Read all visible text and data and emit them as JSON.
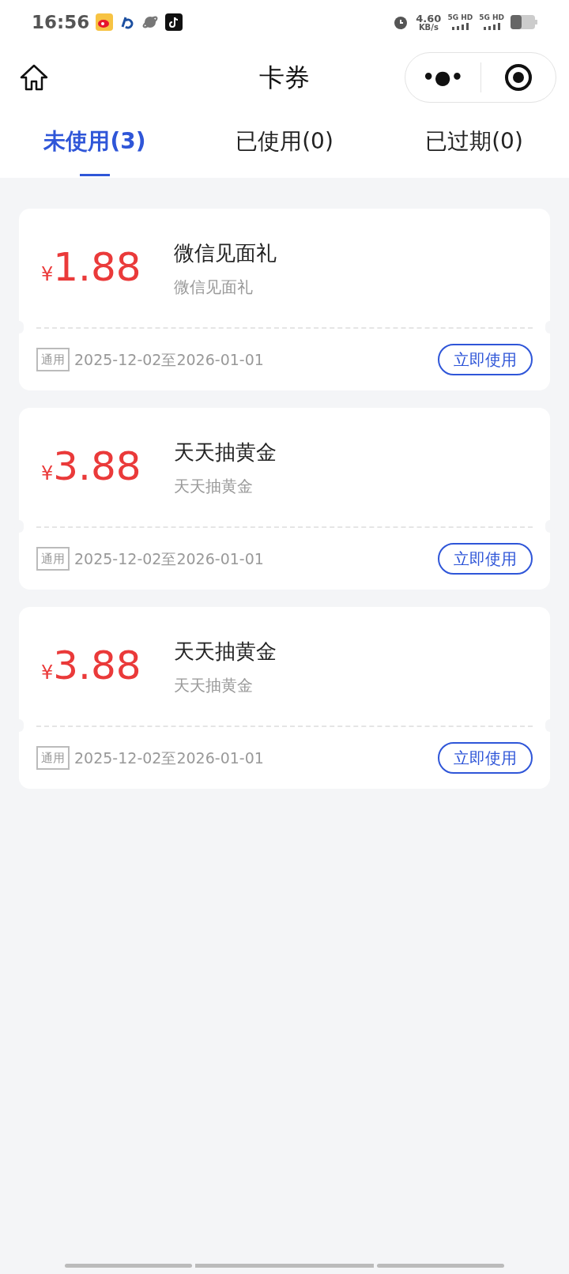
{
  "status_bar": {
    "time": "16:56",
    "speed": "4.60",
    "speed_unit": "KB/s",
    "sim": [
      "5G HD",
      "5G HD"
    ]
  },
  "nav": {
    "title": "卡券",
    "more": "•●•"
  },
  "tabs": [
    {
      "label": "未使用(3)",
      "selected": true
    },
    {
      "label": "已使用(0)",
      "selected": false
    },
    {
      "label": "已过期(0)",
      "selected": false
    }
  ],
  "coupons": [
    {
      "currency": "¥",
      "amount": "1.88",
      "name": "微信见面礼",
      "subtitle": "微信见面礼",
      "tag": "通用",
      "validity": "2025-12-02至2026-01-01",
      "action": "立即使用"
    },
    {
      "currency": "¥",
      "amount": "3.88",
      "name": "天天抽黄金",
      "subtitle": "天天抽黄金",
      "tag": "通用",
      "validity": "2025-12-02至2026-01-01",
      "action": "立即使用"
    },
    {
      "currency": "¥",
      "amount": "3.88",
      "name": "天天抽黄金",
      "subtitle": "天天抽黄金",
      "tag": "通用",
      "validity": "2025-12-02至2026-01-01",
      "action": "立即使用"
    }
  ]
}
